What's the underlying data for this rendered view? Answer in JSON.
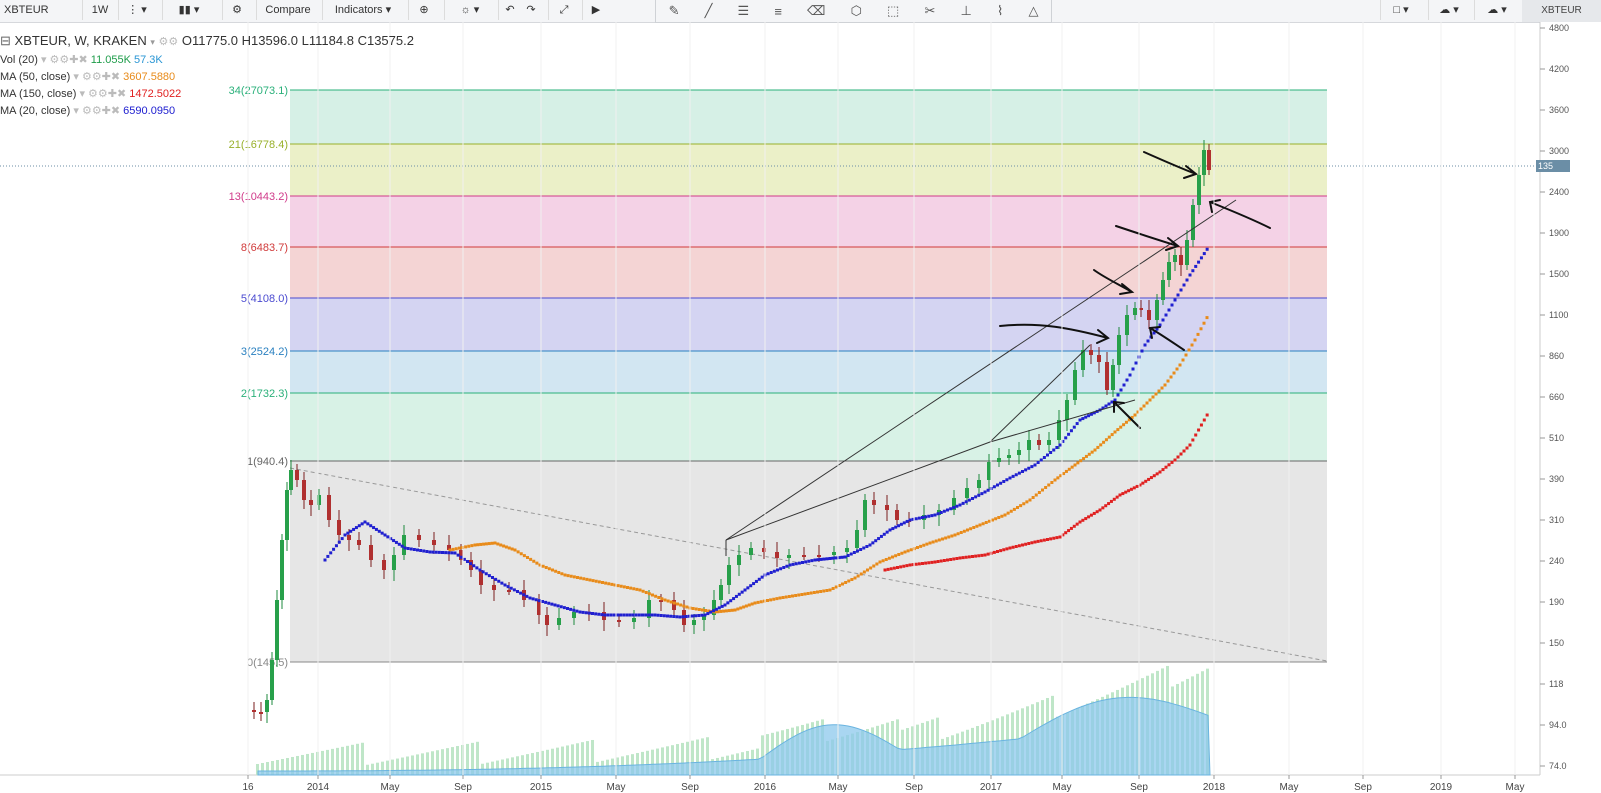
{
  "toolbar": {
    "symbol": "XBTEUR",
    "interval": "1W",
    "compare_label": "Compare",
    "indicators_label": "Indicators",
    "right_symbol": "XBTEUR",
    "icons": [
      "menu-icon",
      "candles-icon",
      "gear-icon",
      "plus-icon",
      "lightbulb-icon",
      "undo-icon",
      "redo-icon",
      "fullscreen-icon",
      "play-icon",
      "cloud-icon",
      "cloud-upload-icon"
    ]
  },
  "header": {
    "title": "XBTEUR, W, KRAKEN",
    "open": "O11775.0",
    "high": "H13596.0",
    "low": "L11184.8",
    "close": "C13575.2"
  },
  "indicators": [
    {
      "name": "Vol (20)",
      "values": [
        "11.055K",
        "57.3K"
      ],
      "colors": [
        "#1e9c4a",
        "#2a96d4"
      ]
    },
    {
      "name": "MA (50, close)",
      "values": [
        "3607.5880"
      ],
      "colors": [
        "#e88b1a"
      ]
    },
    {
      "name": "MA (150, close)",
      "values": [
        "1472.5022"
      ],
      "colors": [
        "#e02020"
      ]
    },
    {
      "name": "MA (20, close)",
      "values": [
        "6590.0950"
      ],
      "colors": [
        "#2020d0"
      ]
    }
  ],
  "fib_labels": [
    "34(27073.1)",
    "21(16778.4)",
    "13(10443.2)",
    "8(6483.7)",
    "5(4108.0)",
    "3(2524.2)",
    "2(1732.3)",
    "1(940.4)",
    "0(145.5)"
  ],
  "fib_colors": [
    "#2ab07a",
    "#98b02a",
    "#d03a8a",
    "#d03a3a",
    "#4a4ad0",
    "#2a80c0",
    "#2ab07a",
    "#666666",
    "#888888"
  ],
  "last_price_label": "135",
  "chart_data": {
    "type": "candlestick",
    "title": "XBTEUR, W, KRAKEN",
    "y_ticks": [
      "4800",
      "4200",
      "3600",
      "3000",
      "2400",
      "1900",
      "1500",
      "1100",
      "860",
      "660",
      "510",
      "390",
      "310",
      "240",
      "190",
      "150",
      "118",
      "94.0",
      "74.0"
    ],
    "x_ticks": [
      "16",
      "2014",
      "May",
      "Sep",
      "2015",
      "May",
      "Sep",
      "2016",
      "May",
      "Sep",
      "2017",
      "May",
      "Sep",
      "2018",
      "May",
      "Sep",
      "2019",
      "May"
    ],
    "fib_levels": [
      {
        "ratio": 34,
        "price": 27073.1
      },
      {
        "ratio": 21,
        "price": 16778.4
      },
      {
        "ratio": 13,
        "price": 10443.2
      },
      {
        "ratio": 8,
        "price": 6483.7
      },
      {
        "ratio": 5,
        "price": 4108.0
      },
      {
        "ratio": 3,
        "price": 2524.2
      },
      {
        "ratio": 2,
        "price": 1732.3
      },
      {
        "ratio": 1,
        "price": 940.4
      },
      {
        "ratio": 0,
        "price": 145.5
      }
    ],
    "ohlc_last": {
      "open": 11775.0,
      "high": 13596.0,
      "low": 11184.8,
      "close": 13575.2
    },
    "moving_averages": [
      {
        "name": "MA (50, close)",
        "last": 3607.588
      },
      {
        "name": "MA (150, close)",
        "last": 1472.5022
      },
      {
        "name": "MA (20, close)",
        "last": 6590.095
      }
    ],
    "volume": {
      "name": "Vol (20)",
      "last": "11.055K",
      "ma": "57.3K"
    }
  }
}
